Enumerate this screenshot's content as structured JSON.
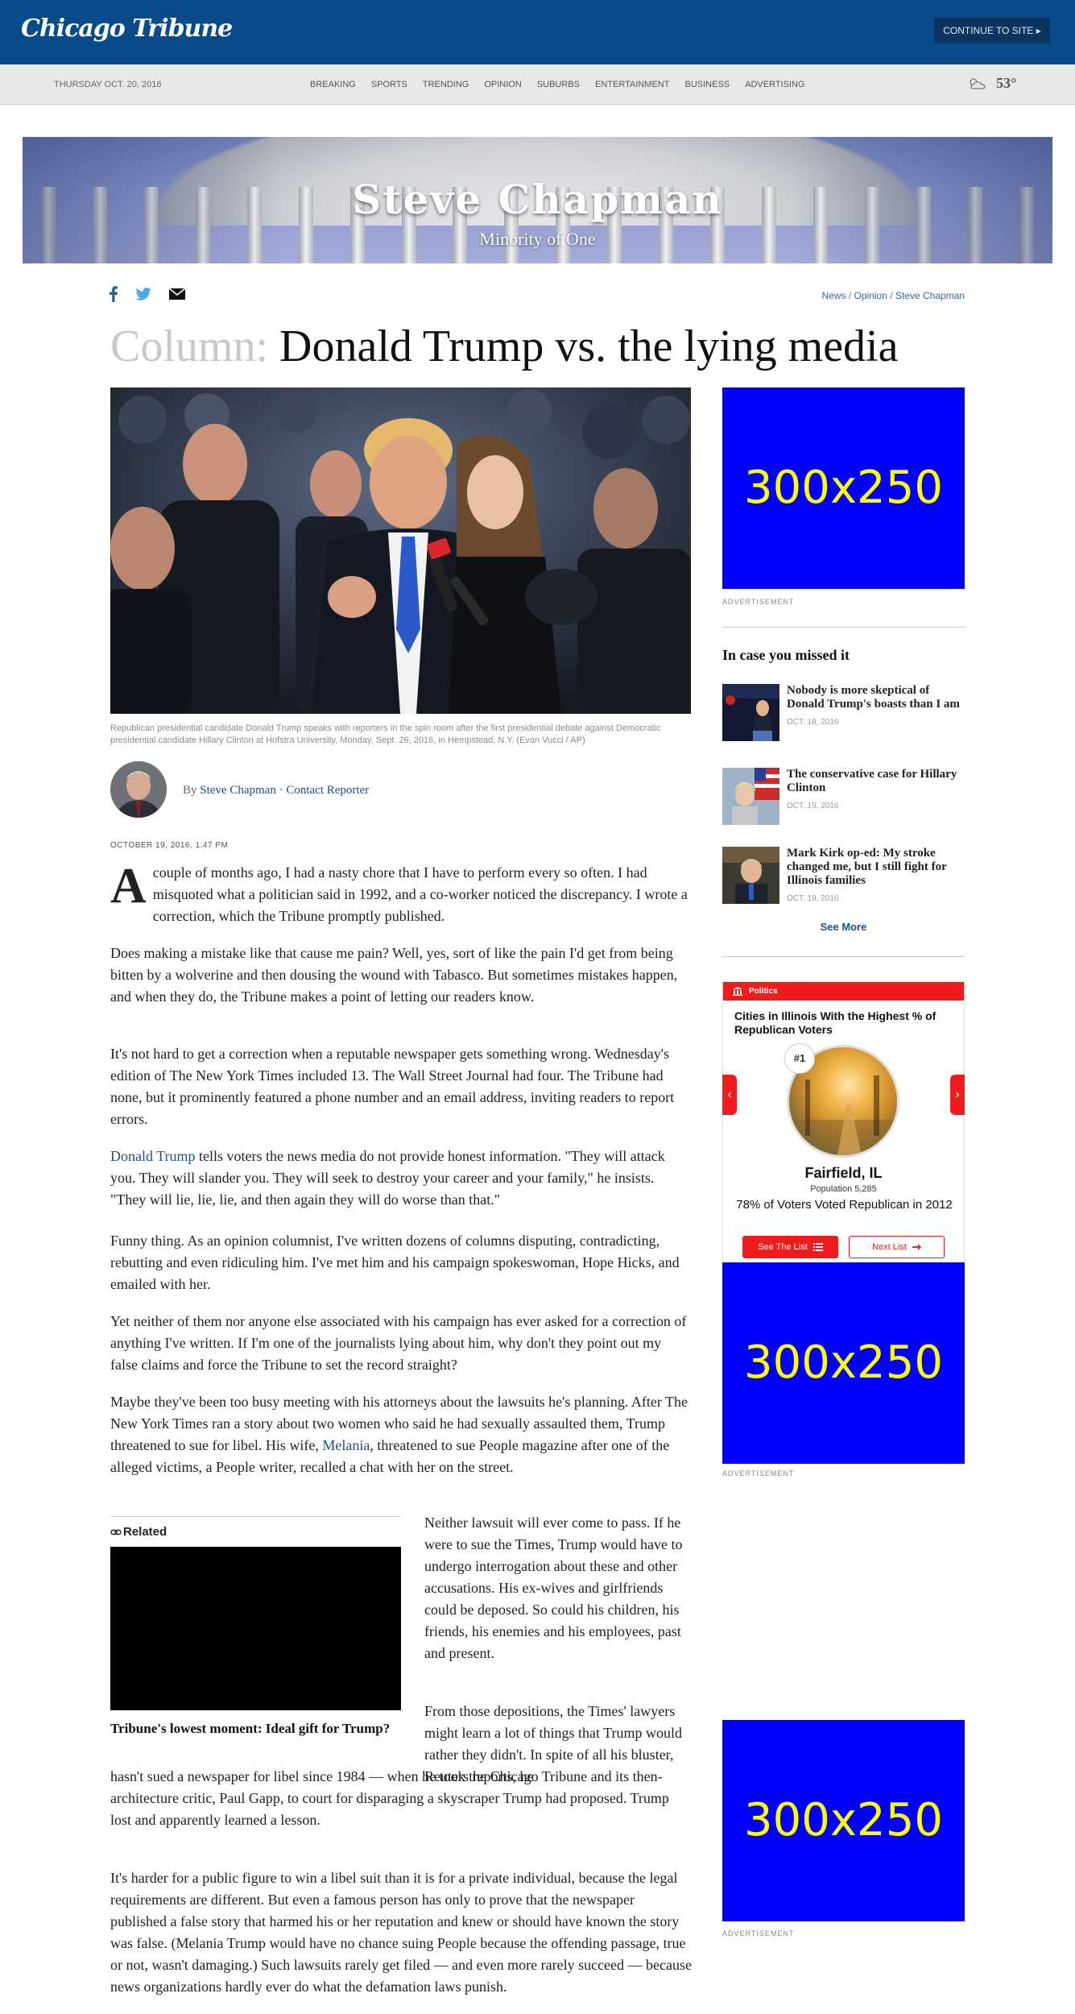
{
  "header": {
    "logo": "Chicago Tribune",
    "continue_label": "CONTINUE TO SITE ▸"
  },
  "nav": {
    "date": "THURSDAY OCT. 20, 2016",
    "links": [
      "BREAKING",
      "SPORTS",
      "TRENDING",
      "OPINION",
      "SUBURBS",
      "ENTERTAINMENT",
      "BUSINESS",
      "ADVERTISING"
    ],
    "weather_temp": "53°"
  },
  "banner": {
    "title": "Steve Chapman",
    "subtitle": "Minority of One"
  },
  "breadcrumb": {
    "items": [
      "News",
      "Opinion",
      "Steve Chapman"
    ],
    "sep": " / "
  },
  "article": {
    "kicker": "Column:",
    "headline": "Donald Trump vs. the lying media",
    "caption": "Republican presidential candidate Donald Trump speaks with reporters in the spin room after the first presidential debate against Democratic presidential candidate Hillary Clinton at Hofstra University, Monday, Sept. 26, 2016, in Hempstead, N.Y. (Evan Vucci / AP)",
    "byline_prefix": "By ",
    "author": "Steve Chapman",
    "byline_sep": " · ",
    "contact": "Contact Reporter",
    "pubdate": "OCTOBER 19, 2016, 1:47 PM",
    "p1_drop": "A",
    "p1": " couple of months ago, I had a nasty chore that I have to perform every so often. I had misquoted what a politician said in 1992, and a co-worker noticed the discrepancy. I wrote a correction, which the Tribune promptly published.",
    "p2": "Does making a mistake like that cause me pain? Well, yes, sort of like the pain I'd get from being bitten by a wolverine and then dousing the wound with Tabasco. But sometimes mistakes happen, and when they do, the Tribune makes a point of letting our readers know.",
    "p3": "It's not hard to get a correction when a reputable newspaper gets something wrong. Wednesday's edition of The New York Times included 13. The Wall Street Journal had four. The Tribune had none, but it prominently featured a phone number and an email address, inviting readers to report errors.",
    "p4_link": "Donald Trump",
    "p4": " tells voters the news media do not provide honest information. \"They will attack you. They will slander you. They will seek to destroy your career and your family,\" he insists. \"They will lie, lie, lie, and then again they will do worse than that.\"",
    "p5": "Funny thing. As an opinion columnist, I've written dozens of columns disputing, contradicting, rebutting and even ridiculing him. I've met him and his campaign spokeswoman, Hope Hicks, and emailed with her.",
    "p6": "Yet neither of them nor anyone else associated with his campaign has ever asked for a correction of anything I've written. If I'm one of the journalists lying about him, why don't they point out my false claims and force the Tribune to set the record straight?",
    "p7a": "Maybe they've been too busy meeting with his attorneys about the lawsuits he's planning. After The New York Times ran a story about two women who said he had sexually assaulted them, Trump threatened to sue for libel. His wife, ",
    "p7_link": "Melania",
    "p7b": ", threatened to sue People magazine after one of the alleged victims, a People writer, recalled a chat with her on the street.",
    "p8": "Neither lawsuit will ever come to pass. If he were to sue the Times, Trump would have to undergo interrogation about these and other accusations. His ex-wives and girlfriends could be deposed. So could his children, his friends, his enemies and his employees, past and present.",
    "p9a": "From those depositions, the Times' lawyers might learn a lot of things that Trump would rather they didn't. In spite of all his bluster, Reuters reports, he",
    "p9b": "hasn't sued a newspaper for libel since 1984 — when he took the Chicago Tribune and its then-architecture critic, Paul Gapp, to court for disparaging a skyscraper Trump had proposed. Trump lost and apparently learned a lesson.",
    "p10": "It's harder for a public figure to win a libel suit than it is for a private individual, because the legal requirements are different. But even a famous person has only to prove that the newspaper published a false story that harmed his or her reputation and knew or should have known the story was false. (Melania Trump would have no chance suing People because the offending passage, true or not, wasn't damaging.) Such lawsuits rarely get filed — and even more rarely succeed — because news organizations hardly ever do what the defamation laws punish."
  },
  "related": {
    "label": "Related",
    "title": "Tribune's lowest moment: Ideal gift for Trump?"
  },
  "sidebar": {
    "ad_text": "300x250",
    "ad_label": "ADVERTISEMENT",
    "missed_title": "In case you missed it",
    "missed_items": [
      {
        "title": "Nobody is more skeptical of Donald Trump's boasts than I am",
        "date": "OCT. 18, 2016"
      },
      {
        "title": "The conservative case for Hillary Clinton",
        "date": "OCT. 19, 2016"
      },
      {
        "title": "Mark Kirk op-ed: My stroke changed me, but I still fight for Illinois families",
        "date": "OCT. 19, 2016"
      }
    ],
    "see_more": "See More"
  },
  "widget": {
    "section": "Politics",
    "question": "Cities in Illinois With the Highest % of Republican Voters",
    "rank": "#1",
    "city": "Fairfield, IL",
    "population": "Population 5,285",
    "stat": "78% of Voters Voted Republican in 2012",
    "see_list": "See The List",
    "next_list": "Next List"
  },
  "colors": {
    "header_bg": "#084b8a",
    "link": "#1d4f8c",
    "ad_bg": "#0000ff",
    "ad_text": "#ffff00",
    "widget_red": "#ee1c1c"
  }
}
